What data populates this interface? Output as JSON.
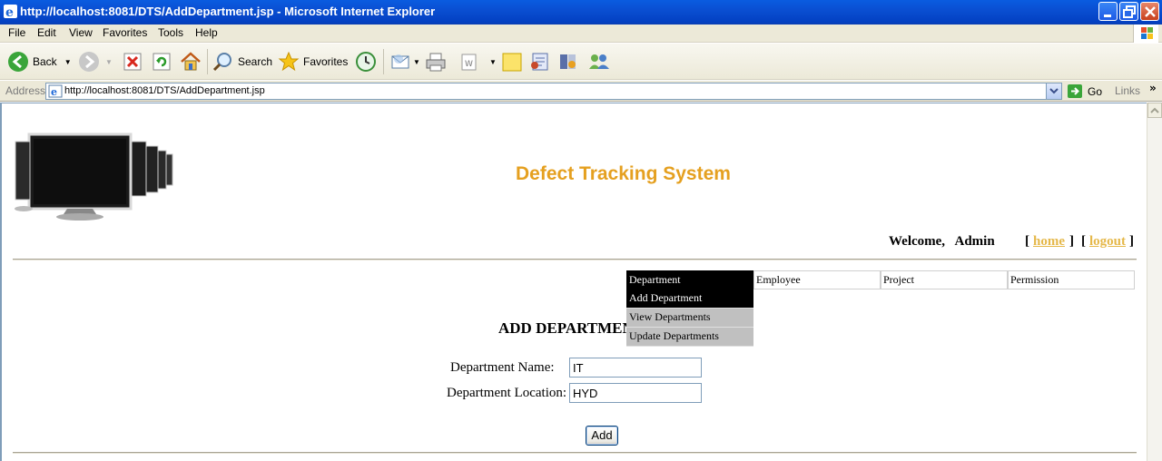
{
  "window": {
    "title": "http://localhost:8081/DTS/AddDepartment.jsp - Microsoft Internet Explorer"
  },
  "menubar": {
    "items": [
      "File",
      "Edit",
      "View",
      "Favorites",
      "Tools",
      "Help"
    ]
  },
  "toolbar": {
    "back_label": "Back",
    "search_label": "Search",
    "favorites_label": "Favorites"
  },
  "addressbar": {
    "label": "Address",
    "url": "http://localhost:8081/DTS/AddDepartment.jsp",
    "go_label": "Go",
    "links_label": "Links"
  },
  "page": {
    "app_title": "Defect Tracking System",
    "welcome_text": "Welcome,   Admin",
    "home_link": "home",
    "logout_link": "logout",
    "nav": {
      "tabs": [
        "Department",
        "Employee",
        "Project",
        "Permission"
      ],
      "department_menu": [
        "Add Department",
        "View Departments",
        "Update Departments"
      ]
    },
    "form": {
      "title": "ADD DEPARTMENT",
      "name_label": "Department Name:",
      "name_value": "IT",
      "location_label": "Department Location:",
      "location_value": "HYD",
      "submit_label": "Add"
    }
  },
  "colors": {
    "title_accent": "#e5a020",
    "link": "#e5b84a",
    "active_menu_bg": "#000000",
    "menu_item_bg": "#c0c0c0"
  }
}
